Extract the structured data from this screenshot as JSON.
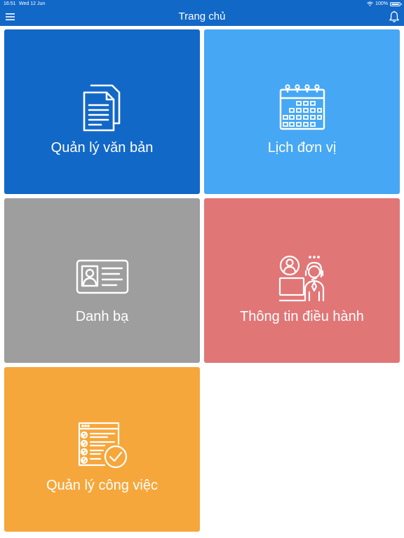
{
  "status": {
    "time": "16:51",
    "date": "Wed 12 Jun",
    "battery": "100%"
  },
  "nav": {
    "title": "Trang chủ",
    "menu_icon": "hamburger-menu-icon",
    "bell_icon": "bell-icon"
  },
  "tiles": [
    {
      "label": "Quản lý văn bản",
      "icon": "documents-icon",
      "color": "#1268c7"
    },
    {
      "label": "Lịch đơn vị",
      "icon": "calendar-icon",
      "color": "#46a7f4"
    },
    {
      "label": "Danh bạ",
      "icon": "contact-card-icon",
      "color": "#9e9e9e"
    },
    {
      "label": "Thông tin điều hành",
      "icon": "operator-support-icon",
      "color": "#e17676"
    },
    {
      "label": "Quản lý công việc",
      "icon": "task-checklist-icon",
      "color": "#f6a73b"
    }
  ]
}
